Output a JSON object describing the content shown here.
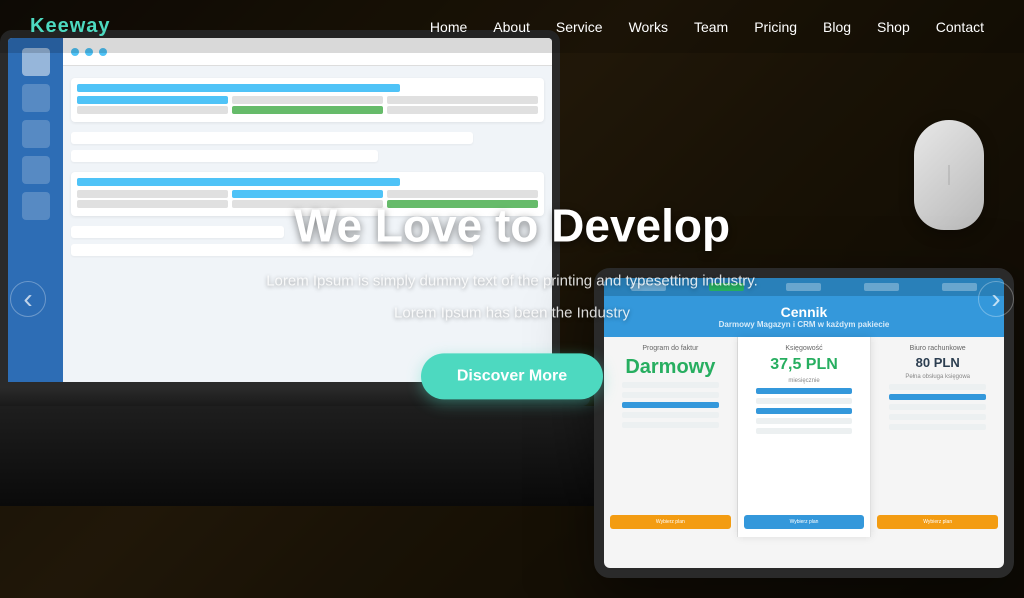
{
  "navbar": {
    "logo": "Keeway",
    "links": [
      {
        "label": "Home",
        "id": "home"
      },
      {
        "label": "About",
        "id": "about"
      },
      {
        "label": "Service",
        "id": "service"
      },
      {
        "label": "Works",
        "id": "works"
      },
      {
        "label": "Team",
        "id": "team"
      },
      {
        "label": "Pricing",
        "id": "pricing"
      },
      {
        "label": "Blog",
        "id": "blog"
      },
      {
        "label": "Shop",
        "id": "shop"
      },
      {
        "label": "Contact",
        "id": "contact"
      }
    ]
  },
  "hero": {
    "title": "We Love to Develop",
    "subtitle_line1": "Lorem Ipsum is simply dummy text of the printing and typesetting industry.",
    "subtitle_line2": "Lorem Ipsum has been the Industry",
    "cta_label": "Discover More"
  },
  "slider": {
    "left_arrow": "‹",
    "right_arrow": "›"
  },
  "tablet": {
    "header_title": "Cennik",
    "header_subtitle": "Darmowy Magazyn i CRM w każdym pakiecie",
    "col1": {
      "label": "Program do faktur",
      "name": "Darmowy"
    },
    "col2": {
      "price": "37,5 PLN",
      "subtitle": "Księgowość"
    },
    "col3": {
      "label": "Biuro rachunkowe",
      "price": "80 PLN",
      "subtitle": "Pełna obsługa księgowa"
    }
  }
}
